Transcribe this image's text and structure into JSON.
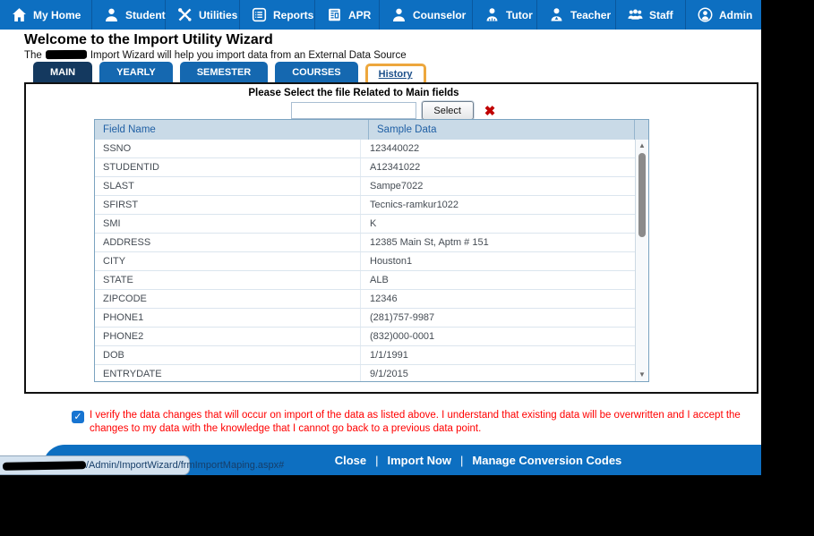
{
  "nav": {
    "items": [
      {
        "label": "My Home",
        "icon": "home-icon"
      },
      {
        "label": "Student",
        "icon": "student-icon"
      },
      {
        "label": "Utilities",
        "icon": "utilities-icon"
      },
      {
        "label": "Reports",
        "icon": "reports-icon"
      },
      {
        "label": "APR",
        "icon": "apr-icon"
      },
      {
        "label": "Counselor",
        "icon": "counselor-icon"
      },
      {
        "label": "Tutor",
        "icon": "tutor-icon"
      },
      {
        "label": "Teacher",
        "icon": "teacher-icon"
      },
      {
        "label": "Staff",
        "icon": "staff-icon"
      },
      {
        "label": "Admin",
        "icon": "admin-icon"
      }
    ]
  },
  "header": {
    "title": "Welcome to the Import Utility Wizard",
    "subtitle_prefix": "The",
    "subtitle_suffix": "Import Wizard will help you import data from an External Data Source"
  },
  "tabs": [
    {
      "label": "MAIN",
      "active": true
    },
    {
      "label": "YEARLY"
    },
    {
      "label": "SEMESTER"
    },
    {
      "label": "COURSES"
    },
    {
      "label": "History",
      "highlighted": true
    }
  ],
  "file_select": {
    "prompt": "Please Select the file Related to Main fields",
    "input_value": "",
    "select_button": "Select"
  },
  "table": {
    "headers": [
      "Field Name",
      "Sample Data"
    ],
    "rows": [
      {
        "field": "SSNO",
        "sample": "123440022"
      },
      {
        "field": "STUDENTID",
        "sample": "A12341022"
      },
      {
        "field": "SLAST",
        "sample": "Sampe7022"
      },
      {
        "field": "SFIRST",
        "sample": "Tecnics-ramkur1022"
      },
      {
        "field": "SMI",
        "sample": "K"
      },
      {
        "field": "ADDRESS",
        "sample": "12385 Main St, Aptm # 151"
      },
      {
        "field": "CITY",
        "sample": "Houston1"
      },
      {
        "field": "STATE",
        "sample": "ALB"
      },
      {
        "field": "ZIPCODE",
        "sample": "12346"
      },
      {
        "field": "PHONE1",
        "sample": "(281)757-9987"
      },
      {
        "field": "PHONE2",
        "sample": "(832)000-0001"
      },
      {
        "field": "DOB",
        "sample": "1/1/1991"
      },
      {
        "field": "ENTRYDATE",
        "sample": "9/1/2015"
      }
    ]
  },
  "verification": {
    "checked": true,
    "text": "I verify the data changes that will occur on import of the data as listed above. I understand that existing data will be overwritten and I accept the changes to my data with the knowledge that I cannot go back to a previous data point."
  },
  "footer": {
    "links": [
      "Close",
      "Import Now",
      "Manage Conversion Codes"
    ]
  },
  "status_bar": {
    "url_path": "/Admin/ImportWizard/frmImportMaping.aspx#"
  },
  "icons": {
    "checkmark": "✓",
    "clear": "✖",
    "scroll_up": "▲",
    "scroll_down": "▼",
    "separator": "|"
  },
  "colors": {
    "nav_blue": "#0d6fc1",
    "tab_active": "#14395f",
    "tab_blue": "#1568b0",
    "highlight_orange": "#eda73d",
    "table_header_bg": "#c9dae7",
    "table_header_text": "#2060a5",
    "alert_red": "#ff0000",
    "clear_red": "#c00000",
    "checkbox_blue": "#1774d1"
  }
}
